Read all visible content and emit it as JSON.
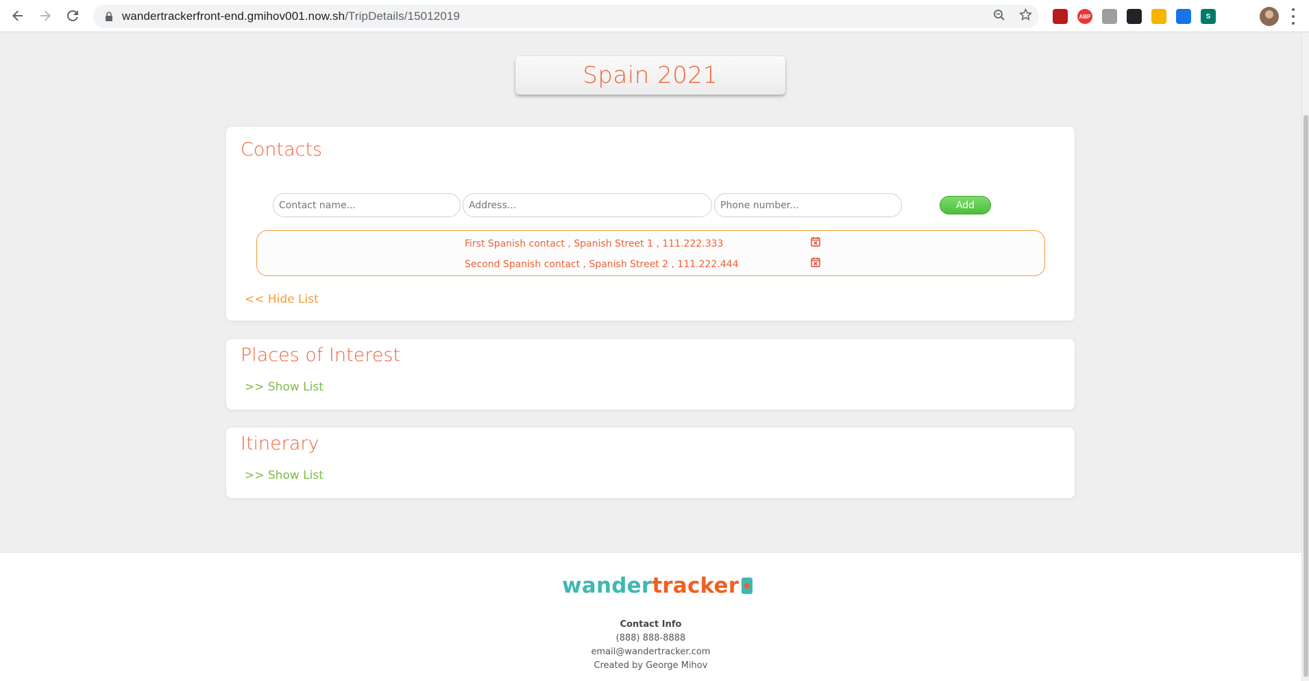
{
  "browser": {
    "url_host": "wandertrackerfront-end.gmihov001.now.sh",
    "url_path": "/TripDetails/15012019",
    "extensions": [
      {
        "name": "pdf-extension-icon",
        "label": "",
        "color": "#b71c1c"
      },
      {
        "name": "adblock-plus-icon",
        "label": "ABP",
        "color": "#e53935"
      },
      {
        "name": "cube-extension-icon",
        "label": "",
        "color": "#9e9e9e"
      },
      {
        "name": "react-devtools-icon",
        "label": "",
        "color": "#20232a"
      },
      {
        "name": "color-picker-icon",
        "label": "",
        "color": "#f4b400"
      },
      {
        "name": "eyedropper-icon",
        "label": "",
        "color": "#1a73e8"
      },
      {
        "name": "stylus-extension-icon",
        "label": "S",
        "color": "#00796b"
      }
    ]
  },
  "trip": {
    "title": "Spain 2021"
  },
  "contacts": {
    "title": "Contacts",
    "name_placeholder": "Contact name...",
    "address_placeholder": "Address...",
    "phone_placeholder": "Phone number...",
    "add_label": "Add",
    "items": [
      {
        "text": "First Spanish contact , Spanish Street 1 , 111.222.333"
      },
      {
        "text": "Second Spanish contact , Spanish Street 2 , 111.222.444"
      }
    ],
    "toggle_label": "<< Hide List"
  },
  "places": {
    "title": "Places of Interest",
    "toggle_label": ">> Show List"
  },
  "itinerary": {
    "title": "Itinerary",
    "toggle_label": ">> Show List"
  },
  "footer": {
    "logo_part1": "wander",
    "logo_part2": "tracker",
    "contact_heading": "Contact Info",
    "phone": "(888) 888-8888",
    "email": "email@wandertracker.com",
    "credit": "Created by George Mihov"
  },
  "colors": {
    "accent": "#f0613a",
    "hide_toggle": "#f39c3a",
    "show_toggle": "#7cbb44",
    "add_button": "#4cbe3c",
    "logo_teal": "#3fb8b3"
  }
}
